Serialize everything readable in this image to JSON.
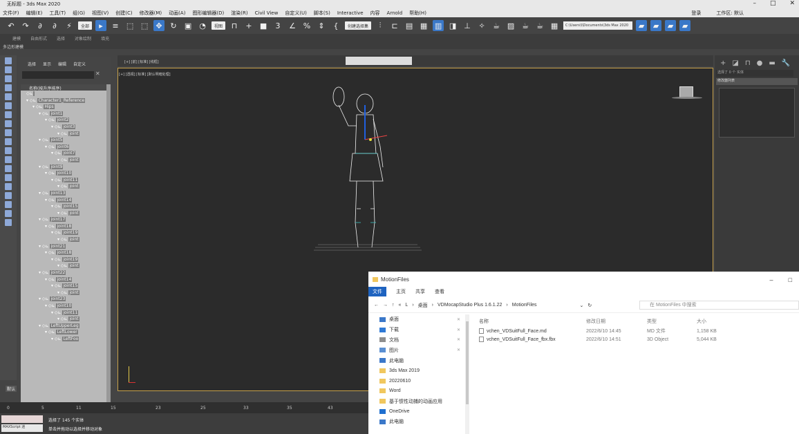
{
  "app": {
    "title": "无标题 - 3ds Max 2020",
    "win_min": "–",
    "win_max": "□",
    "win_close": "✕"
  },
  "menu": {
    "items": [
      "文件(F)",
      "编辑(E)",
      "工具(T)",
      "组(G)",
      "视图(V)",
      "创建(C)",
      "修改器(M)",
      "动画(A)",
      "图形编辑器(D)",
      "渲染(R)",
      "Civil View",
      "自定义(U)",
      "脚本(S)",
      "Interactive",
      "内容",
      "Arnold",
      "帮助(H)"
    ],
    "signin": "登录",
    "workspace": "工作区: 默认"
  },
  "toolbar": {
    "selection_filter": "全部",
    "view_dropdown": "视图",
    "selection_set": "创建选择集",
    "project_path": "C:\\Users\\l\\Documents\\3ds Max 2020"
  },
  "ribbon": {
    "tabs": [
      "建模",
      "自由形式",
      "选择",
      "对象绘制",
      "填充"
    ],
    "subtitle": "多边形建模"
  },
  "scene_explorer": {
    "tabs": [
      "选择",
      "显示",
      "编辑",
      "自定义"
    ],
    "column_header": "名称(按升序排序)",
    "nodes": [
      {
        "label": "",
        "depth": 0
      },
      {
        "label": "Character1_Reference",
        "depth": 0
      },
      {
        "label": "Hips",
        "depth": 1
      },
      {
        "label": "joint1",
        "depth": 2
      },
      {
        "label": "joint2",
        "depth": 3
      },
      {
        "label": "joint3",
        "depth": 4
      },
      {
        "label": "joint",
        "depth": 5
      },
      {
        "label": "joint5",
        "depth": 2
      },
      {
        "label": "joint6",
        "depth": 3
      },
      {
        "label": "joint7",
        "depth": 4
      },
      {
        "label": "joint",
        "depth": 5
      },
      {
        "label": "joint9",
        "depth": 2
      },
      {
        "label": "joint10",
        "depth": 3
      },
      {
        "label": "joint11",
        "depth": 4
      },
      {
        "label": "joint",
        "depth": 5
      },
      {
        "label": "joint13",
        "depth": 2
      },
      {
        "label": "joint14",
        "depth": 3
      },
      {
        "label": "joint15",
        "depth": 4
      },
      {
        "label": "joint",
        "depth": 5
      },
      {
        "label": "joint17",
        "depth": 2
      },
      {
        "label": "joint18",
        "depth": 3
      },
      {
        "label": "joint19",
        "depth": 4
      },
      {
        "label": "joint",
        "depth": 5
      },
      {
        "label": "joint21",
        "depth": 2
      },
      {
        "label": "joint18",
        "depth": 3
      },
      {
        "label": "joint19",
        "depth": 4
      },
      {
        "label": "joint",
        "depth": 5
      },
      {
        "label": "joint22",
        "depth": 2
      },
      {
        "label": "joint14",
        "depth": 3
      },
      {
        "label": "joint15",
        "depth": 4
      },
      {
        "label": "joint",
        "depth": 5
      },
      {
        "label": "joint23",
        "depth": 2
      },
      {
        "label": "joint10",
        "depth": 3
      },
      {
        "label": "joint11",
        "depth": 4
      },
      {
        "label": "joint",
        "depth": 5
      },
      {
        "label": "LeftUpperLeg",
        "depth": 2
      },
      {
        "label": "LeftLower",
        "depth": 3
      },
      {
        "label": "LeftFoo",
        "depth": 4
      }
    ],
    "default_label": "默认"
  },
  "viewport": {
    "label_top": "[+] [前] [标准] [线框]",
    "label": "[+] [透视] [标准] [默认明暗处理]"
  },
  "right_panel": {
    "selection_field": "选择了 0 个 实体",
    "modifier_list": "修改器列表"
  },
  "timeline": {
    "ticks": [
      "0",
      "5",
      "11",
      "15",
      "23",
      "25",
      "33",
      "35",
      "43"
    ]
  },
  "status": {
    "maxscript": "MAXScript 迷",
    "message1": "选择了 145 个实体",
    "message2": "单击并拖动以选择并移动对象"
  },
  "file_explorer": {
    "title": "MotionFiles",
    "ribbon_tabs": [
      "文件",
      "主页",
      "共享",
      "查看"
    ],
    "breadcrumb": [
      "«",
      "L",
      "桌面",
      "VDMocapStudio Plus 1.6.1.22",
      "MotionFiles"
    ],
    "search_placeholder": "在 MotionFiles 中搜索",
    "nav": [
      {
        "label": "桌面",
        "icon": "#3b78c9"
      },
      {
        "label": "下载",
        "icon": "#2f7ad6"
      },
      {
        "label": "文档",
        "icon": "#8e8e8e"
      },
      {
        "label": "图片",
        "icon": "#5a8fd2"
      },
      {
        "label": "此电脑",
        "icon": "#3b78c9"
      },
      {
        "label": "3ds Max 2019",
        "icon": "#f1c75e"
      },
      {
        "label": "20220610",
        "icon": "#f1c75e"
      },
      {
        "label": "Word",
        "icon": "#f1c75e"
      },
      {
        "label": "基于惯性动捕的动画应用",
        "icon": "#f1c75e"
      },
      {
        "label": "OneDrive",
        "icon": "#1e6fd0"
      },
      {
        "label": "此电脑",
        "icon": "#3b78c9"
      }
    ],
    "columns": {
      "name": "名称",
      "date": "修改日期",
      "type": "类型",
      "size": "大小"
    },
    "files": [
      {
        "name": "vchen_VDSuitFull_Face.md",
        "date": "2022/6/10 14:45",
        "type": "MD 文件",
        "size": "1,158 KB"
      },
      {
        "name": "vchen_VDSuitFull_Face_fbx.fbx",
        "date": "2022/6/10 14:51",
        "type": "3D Object",
        "size": "5,044 KB"
      }
    ]
  }
}
